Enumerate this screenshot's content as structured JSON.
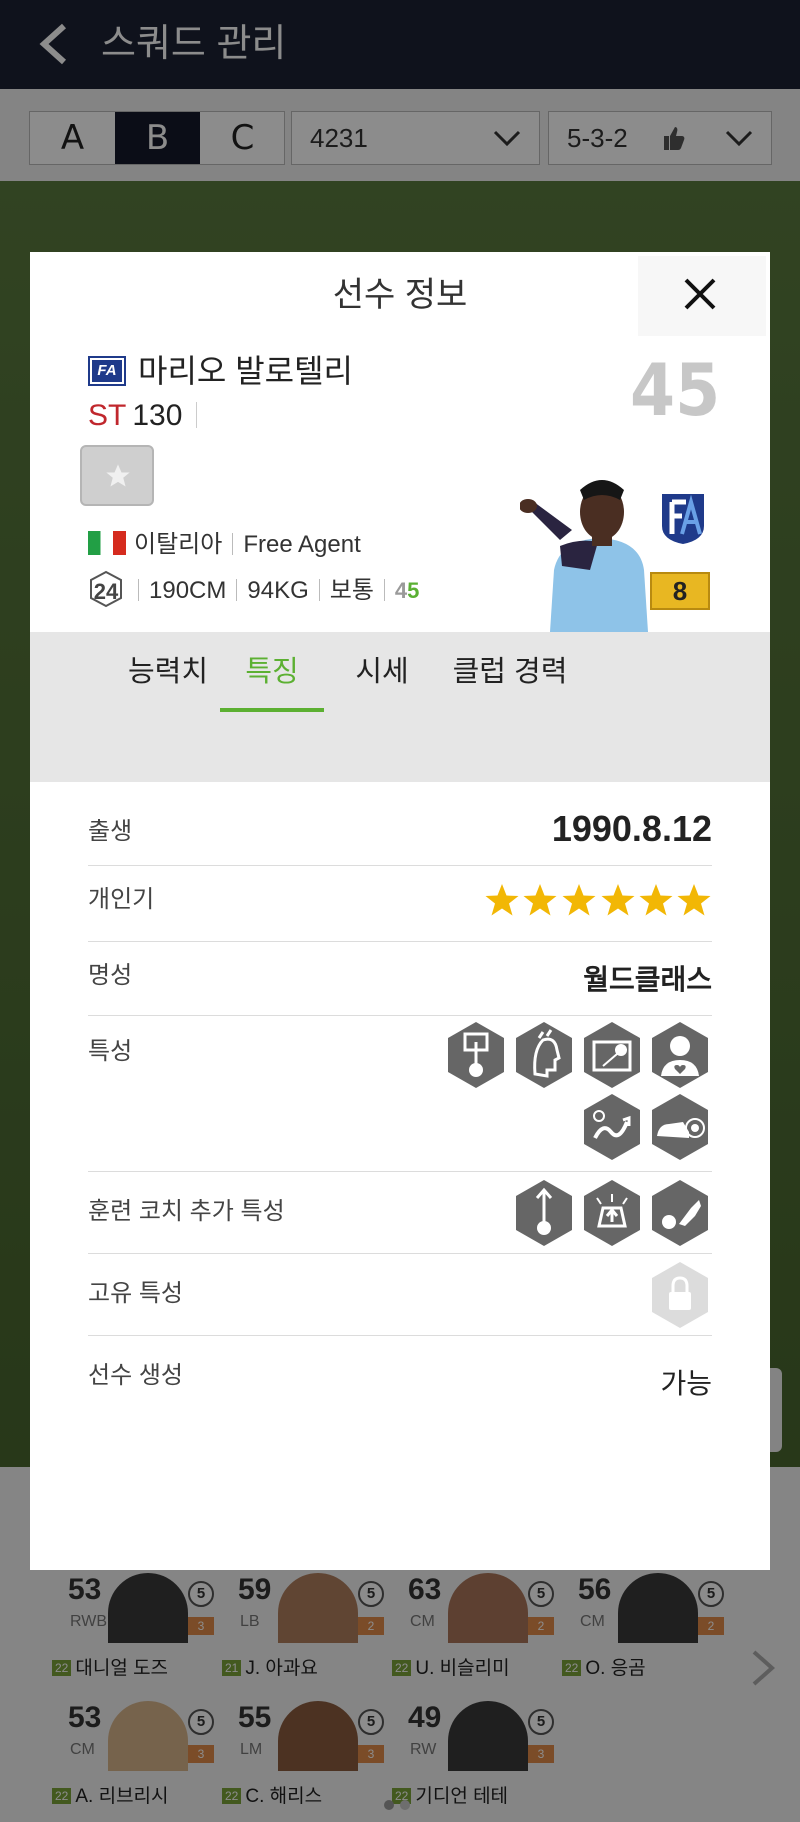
{
  "header": {
    "title": "스쿼드 관리"
  },
  "toolbar": {
    "squad_tabs": [
      "A",
      "B",
      "C"
    ],
    "active_tab": "B",
    "formation": "4231",
    "tactic": "5-3-2"
  },
  "modal": {
    "title": "선수 정보",
    "player": {
      "badge": "FA",
      "name": "마리오 발로텔리",
      "position": "ST",
      "position_ovr": "130",
      "ovr": "45",
      "nation": "이탈리아",
      "club": "Free Agent",
      "age": "24",
      "height": "190CM",
      "weight": "94KG",
      "build": "보통",
      "weak_foot": "4",
      "strong_foot": "5",
      "level": "8"
    },
    "tabs": [
      "능력치",
      "특징",
      "시세",
      "클럽 경력"
    ],
    "active_tab": "특징",
    "info": {
      "birth_label": "출생",
      "birth_value": "1990.8.12",
      "popularity_label": "개인기",
      "popularity_stars": 6,
      "reputation_label": "명성",
      "reputation_value": "월드클래스",
      "traits_label": "특성",
      "traits_icons": [
        "finesse-shot-trait-icon",
        "flair-trait-icon",
        "long-shot-trait-icon",
        "team-player-trait-icon",
        "dribbler-trait-icon",
        "power-shot-trait-icon"
      ],
      "coach_traits_label": "훈련 코치 추가 특성",
      "coach_traits_icons": [
        "finesse-shot-coach-icon",
        "chip-shot-coach-icon",
        "flair-coach-icon"
      ],
      "unique_trait_label": "고유 특성",
      "creation_label": "선수 생성",
      "creation_value": "가능"
    }
  },
  "bench": {
    "players": [
      {
        "ovr": "53",
        "pos": "RWB",
        "level": "5",
        "year": "22",
        "name": "대니얼 도즈"
      },
      {
        "ovr": "59",
        "pos": "LB",
        "level": "5",
        "year": "21",
        "name": "J. 아과요"
      },
      {
        "ovr": "63",
        "pos": "CM",
        "level": "5",
        "year": "22",
        "name": "U. 비슬리미"
      },
      {
        "ovr": "56",
        "pos": "CM",
        "level": "5",
        "year": "22",
        "name": "O. 응곰"
      },
      {
        "ovr": "53",
        "pos": "CM",
        "level": "5",
        "year": "22",
        "name": "A. 리브리시"
      },
      {
        "ovr": "55",
        "pos": "LM",
        "level": "5",
        "year": "22",
        "name": "C. 해리스"
      },
      {
        "ovr": "49",
        "pos": "RW",
        "level": "5",
        "year": "22",
        "name": "기디언 테테"
      }
    ]
  },
  "colors": {
    "accent_green": "#5cb032",
    "position_red": "#c0272d",
    "star_gold": "#f2b705",
    "header_navy": "#1d2233"
  }
}
